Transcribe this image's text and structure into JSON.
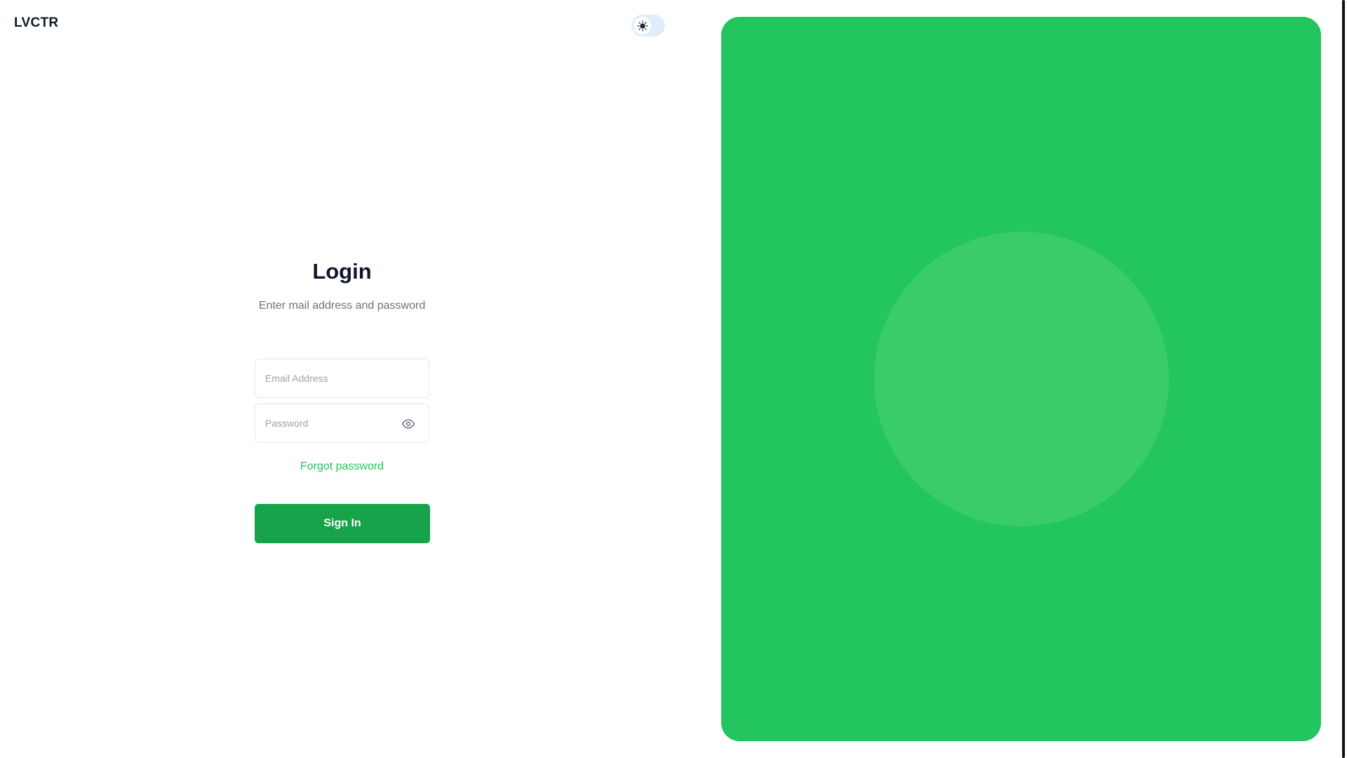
{
  "brand": {
    "name": "LVCTR"
  },
  "theme_toggle": {
    "icon": "sun-icon",
    "mode": "light"
  },
  "login": {
    "title": "Login",
    "subtitle": "Enter mail address and password",
    "email": {
      "placeholder": "Email Address",
      "value": ""
    },
    "password": {
      "placeholder": "Password",
      "value": "",
      "toggle_icon": "eye-icon"
    },
    "forgot_label": "Forgot password",
    "submit_label": "Sign In"
  },
  "colors": {
    "brand_text": "#0f172a",
    "accent": "#22c55e",
    "button": "#16a34a",
    "panel": "#22c55e",
    "panel_circle": "#3acb6b",
    "toggle_bg": "#e0ecff"
  }
}
